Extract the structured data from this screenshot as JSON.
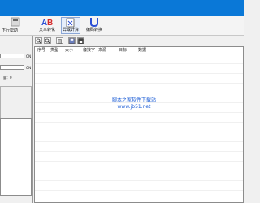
{
  "toolbar": {
    "partial_label": "下行帮助",
    "items": [
      {
        "label": "文本转化",
        "icon": "text-convert-icon"
      },
      {
        "label": "异或计算",
        "icon": "xor-calc-icon"
      },
      {
        "label": "编码转换",
        "icon": "encode-convert-icon"
      }
    ]
  },
  "left_panel": {
    "field_suffix_1": "ON",
    "field_suffix_2": "ON",
    "count_label": "量：0"
  },
  "grid": {
    "columns": [
      "序号",
      "类型",
      "大小",
      "套接字",
      "来源",
      "目标",
      "数据"
    ]
  },
  "watermark": {
    "line1": "脚本之家软件下载站",
    "line2": "www.jb51.net"
  },
  "colors": {
    "titlebar": "#0a78d7",
    "watermark": "#1f5fd6"
  }
}
